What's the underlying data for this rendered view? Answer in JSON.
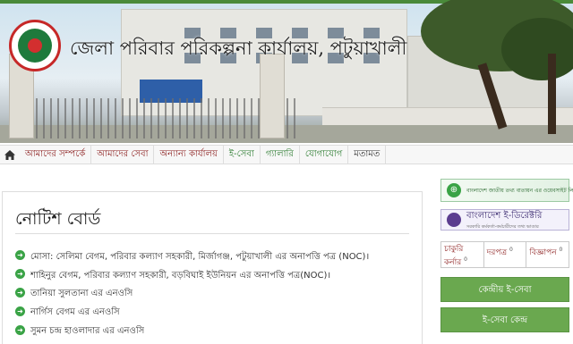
{
  "header": {
    "office_title": "জেলা পরিবার পরিকল্পনা কার্যালয়, পটুয়াখালী",
    "logo": "bangladesh-government-seal"
  },
  "nav": {
    "home_icon": "home-icon",
    "items": [
      "আমাদের সম্পর্কে",
      "আমাদের সেবা",
      "অন্যান্য কার্যালয়",
      "ই-সেবা",
      "গ্যালারি",
      "যোগাযোগ",
      "মতামত"
    ]
  },
  "notice_board": {
    "title": "নোটিশ বোর্ড",
    "items": [
      "মোসা: সেলিমা বেগম, পরিবার কল্যাণ সহকারী, মির্জাগঞ্জ, পটুয়াখালী এর অনাপত্তি পত্র (NOC)।",
      "শাহিনুর বেগম, পরিবার কল্যাণ সহকারী, বড়বিঘাই ইউনিয়ন এর অনাপত্তি পত্র(NOC)।",
      "তানিয়া সুলতানা এর এনওসি",
      "নার্গিস বেগম এর এনওসি",
      "সুমন চন্দ্র হাওলাদার এর এনওসি"
    ]
  },
  "sidebar": {
    "portal_banner": "বাংলাদেশ জাতীয় তথ্য বাতায়ন এর ওয়েবসাইট লিংক",
    "edirectory_title": "বাংলাদেশ ই-ডিরেক্টরি",
    "edirectory_subtitle": "সরকারি কর্মকর্তা-কর্মচারীদের তথ্য ভাণ্ডার",
    "tabs": [
      {
        "label": "চাকুরি কর্নার",
        "count": "0"
      },
      {
        "label": "দরপত্র",
        "count": "0"
      },
      {
        "label": "বিজ্ঞাপন",
        "count": "0"
      }
    ],
    "central_eservice": "কেন্দ্রীয় ই-সেবা",
    "eservice_center": "ই-সেবা কেন্দ্র"
  },
  "colors": {
    "accent_green": "#6aa84f",
    "nav_text_red": "#8b1d1d",
    "seal_red": "#c62828"
  }
}
